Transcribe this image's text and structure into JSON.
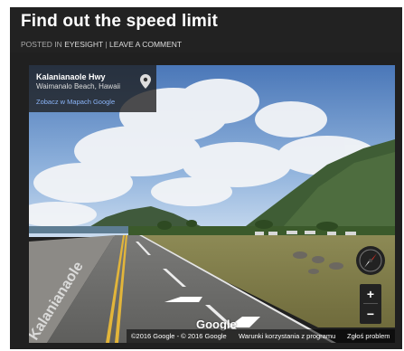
{
  "post": {
    "title": "Find out the speed limit",
    "meta_prefix": "POSTED IN ",
    "category": "EYESIGHT",
    "separator": "|",
    "comment_link": "LEAVE A COMMENT"
  },
  "streetview": {
    "location_name": "Kalanianaole Hwy",
    "location_sub": "Waimanalo Beach, Hawaii",
    "maps_link": "Zobacz w Mapach Google",
    "logo": "Google",
    "copyright": "©2016 Google - © 2016 Google",
    "terms_link": "Warunki korzystania z programu",
    "report_link": "Zgłoś problem",
    "road_text": "Kalanianaole",
    "zoom_in": "+",
    "zoom_out": "−",
    "icons": [
      "map-pin-icon",
      "compass-icon",
      "navigation-arrow-icon"
    ]
  },
  "colors": {
    "header_bg": "#222222",
    "link_blue": "#8ab4f8",
    "compass_red": "#d93025"
  }
}
